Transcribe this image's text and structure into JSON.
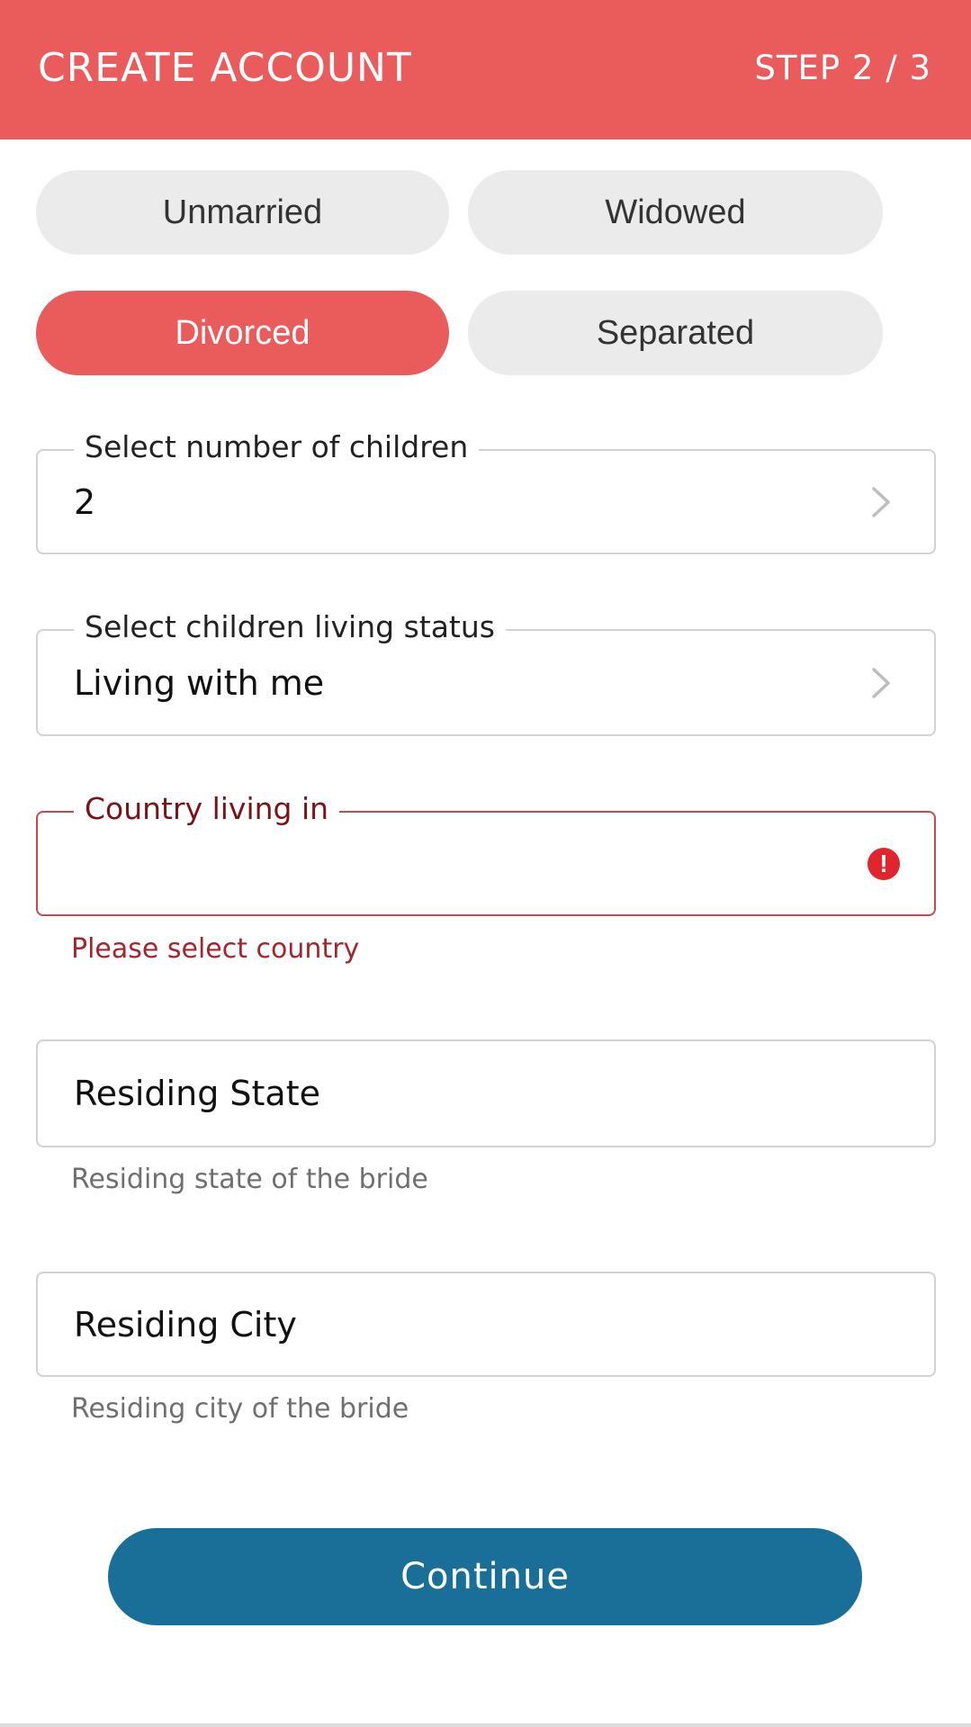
{
  "header": {
    "title": "CREATE ACCOUNT",
    "step": "STEP 2 / 3"
  },
  "marital_status": {
    "options": [
      "Unmarried",
      "Widowed",
      "Divorced",
      "Separated"
    ],
    "selected": "Divorced"
  },
  "children_count": {
    "label": "Select number of children",
    "value": "2",
    "icon": "chevron-right-icon"
  },
  "children_living": {
    "label": "Select children living status",
    "value": "Living with me",
    "icon": "chevron-right-icon"
  },
  "country": {
    "label": "Country living in",
    "value": "",
    "error": "Please select country",
    "icon": "error-icon"
  },
  "state": {
    "placeholder": "Residing State",
    "helper": "Residing state of the bride"
  },
  "city": {
    "placeholder": "Residing City",
    "helper": "Residing city of the bride"
  },
  "actions": {
    "continue_label": "Continue"
  },
  "colors": {
    "accent": "#ea5b5c",
    "primary_button": "#1a6f98",
    "error": "#a4262c",
    "chip_bg": "#ebebeb"
  }
}
